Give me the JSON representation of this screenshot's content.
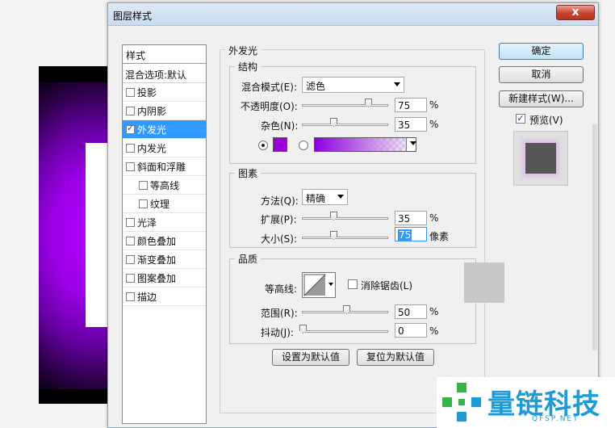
{
  "dialog": {
    "title": "图层样式",
    "close_glyph": "x"
  },
  "styles_panel": {
    "header": "样式",
    "blend_options": "混合选项:默认",
    "items": [
      {
        "label": "投影",
        "checked": false
      },
      {
        "label": "内阴影",
        "checked": false
      },
      {
        "label": "外发光",
        "checked": true,
        "selected": true
      },
      {
        "label": "内发光",
        "checked": false
      },
      {
        "label": "斜面和浮雕",
        "checked": false
      },
      {
        "label": "等高线",
        "checked": false,
        "indent": true
      },
      {
        "label": "纹理",
        "checked": false,
        "indent": true
      },
      {
        "label": "光泽",
        "checked": false
      },
      {
        "label": "颜色叠加",
        "checked": false
      },
      {
        "label": "渐变叠加",
        "checked": false
      },
      {
        "label": "图案叠加",
        "checked": false
      },
      {
        "label": "描边",
        "checked": false
      }
    ]
  },
  "outer_glow": {
    "title": "外发光",
    "structure": {
      "title": "结构",
      "blend_mode_label": "混合模式(E):",
      "blend_mode_value": "滤色",
      "opacity_label": "不透明度(O):",
      "opacity_value": "75",
      "noise_label": "杂色(N):",
      "noise_value": "35",
      "percent": "%",
      "opacity": 0.75,
      "noise": 0.35,
      "color": "#9a00d6"
    },
    "elements": {
      "title": "图素",
      "method_label": "方法(Q):",
      "method_value": "精确",
      "spread_label": "扩展(P):",
      "spread_value": "35",
      "size_label": "大小(S):",
      "size_value": "75",
      "size_unit": "像素",
      "percent": "%"
    },
    "quality": {
      "title": "品质",
      "contour_label": "等高线:",
      "anti_alias_label": "消除锯齿(L)",
      "range_label": "范围(R):",
      "range_value": "50",
      "jitter_label": "抖动(J):",
      "jitter_value": "0",
      "percent": "%"
    },
    "set_default": "设置为默认值",
    "reset_default": "复位为默认值"
  },
  "buttons": {
    "ok": "确定",
    "cancel": "取消",
    "new_style": "新建样式(W)...",
    "preview": "预览(V)"
  },
  "watermark": {
    "text": "量链科技",
    "sub": "QFSP.NET"
  }
}
